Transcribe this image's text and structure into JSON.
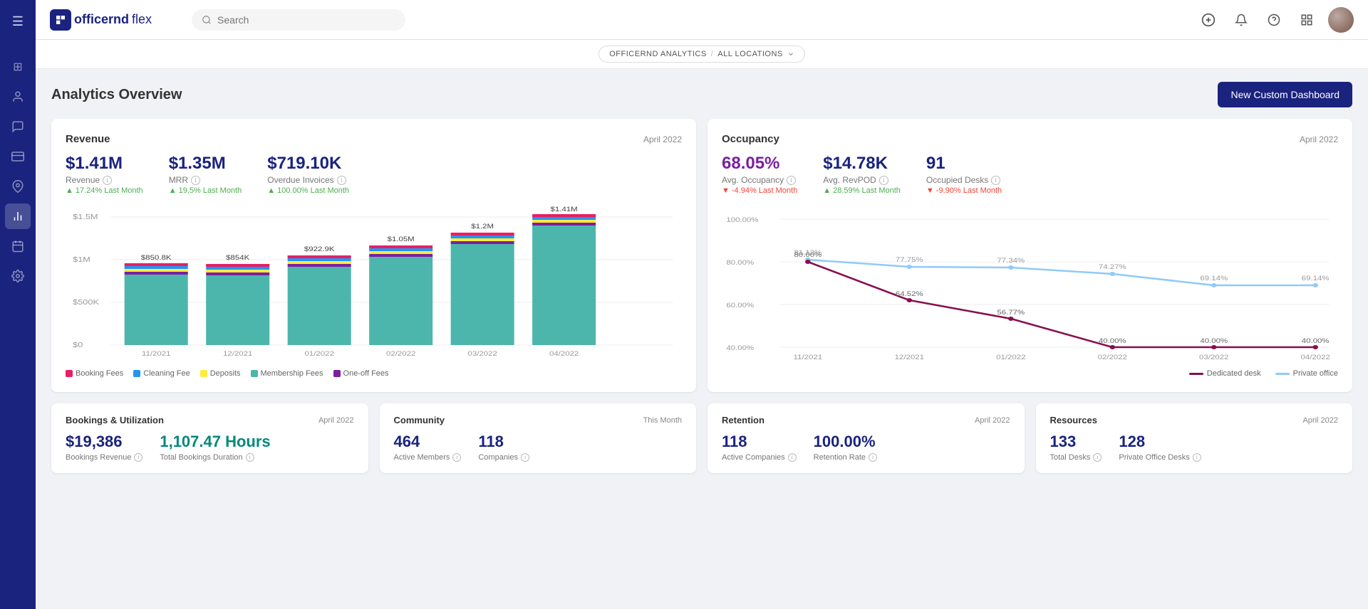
{
  "app": {
    "name": "officernd",
    "subtitle": "flex"
  },
  "nav": {
    "search_placeholder": "Search",
    "location_text": "OFFICERND ANALYTICS",
    "location_sep": "/",
    "location_scope": "ALL LOCATIONS"
  },
  "page": {
    "title": "Analytics Overview",
    "new_dashboard_button": "New Custom Dashboard"
  },
  "revenue_card": {
    "title": "Revenue",
    "period": "April 2022",
    "metrics": [
      {
        "value": "$1.41M",
        "label": "Revenue",
        "change": "17.24% Last Month",
        "direction": "up"
      },
      {
        "value": "$1.35M",
        "label": "MRR",
        "change": "19.5% Last Month",
        "direction": "up"
      },
      {
        "value": "$719.10K",
        "label": "Overdue Invoices",
        "change": "100.00% Last Month",
        "direction": "up"
      }
    ],
    "chart": {
      "y_labels": [
        "$1.5M",
        "$1M",
        "$500K",
        "$0"
      ],
      "bars": [
        {
          "month": "11/2021",
          "total": "$850.8K",
          "booking": 5,
          "cleaning": 3,
          "deposit": 2,
          "membership": 78,
          "oneoff": 12
        },
        {
          "month": "12/2021",
          "total": "$854K",
          "booking": 4,
          "cleaning": 3,
          "deposit": 2,
          "membership": 79,
          "oneoff": 12
        },
        {
          "month": "01/2022",
          "total": "$922.9K",
          "booking": 4,
          "cleaning": 3,
          "deposit": 2,
          "membership": 80,
          "oneoff": 11
        },
        {
          "month": "02/2022",
          "total": "$1.05M",
          "booking": 4,
          "cleaning": 3,
          "deposit": 2,
          "membership": 80,
          "oneoff": 11
        },
        {
          "month": "03/2022",
          "total": "$1.2M",
          "booking": 4,
          "cleaning": 3,
          "deposit": 2,
          "membership": 80,
          "oneoff": 11
        },
        {
          "month": "04/2022",
          "total": "$1.41M",
          "booking": 4,
          "cleaning": 3,
          "deposit": 2,
          "membership": 80,
          "oneoff": 11
        }
      ]
    },
    "legend": [
      {
        "label": "Booking Fees",
        "color": "#e91e63"
      },
      {
        "label": "Cleaning Fee",
        "color": "#2196f3"
      },
      {
        "label": "Deposits",
        "color": "#ffeb3b"
      },
      {
        "label": "Membership Fees",
        "color": "#4db6ac"
      },
      {
        "label": "One-off Fees",
        "color": "#7b1fa2"
      }
    ]
  },
  "occupancy_card": {
    "title": "Occupancy",
    "period": "April 2022",
    "metrics": [
      {
        "value": "68.05%",
        "label": "Avg. Occupancy",
        "change": "-4.94% Last Month",
        "direction": "down"
      },
      {
        "value": "$14.78K",
        "label": "Avg. RevPOD",
        "change": "28.59% Last Month",
        "direction": "up"
      },
      {
        "value": "91",
        "label": "Occupied Desks",
        "change": "-9.90% Last Month",
        "direction": "down"
      }
    ],
    "chart": {
      "y_labels": [
        "100.00%",
        "80.00%",
        "60.00%",
        "40.00%"
      ],
      "x_labels": [
        "11/2021",
        "12/2021",
        "01/2022",
        "02/2022",
        "03/2022",
        "04/2022"
      ],
      "dedicated_desk_points": [
        {
          "x": 0,
          "y": 80.0
        },
        {
          "x": 1,
          "y": 64.52
        },
        {
          "x": 2,
          "y": 56.77
        },
        {
          "x": 3,
          "y": 40.0
        },
        {
          "x": 4,
          "y": 40.0
        },
        {
          "x": 5,
          "y": 40.0
        }
      ],
      "private_office_points": [
        {
          "x": 0,
          "y": 81.12
        },
        {
          "x": 1,
          "y": 77.75
        },
        {
          "x": 2,
          "y": 77.34
        },
        {
          "x": 3,
          "y": 74.27
        },
        {
          "x": 4,
          "y": 69.14
        },
        {
          "x": 5,
          "y": 69.14
        }
      ],
      "dedicated_desk_labels": [
        "80.00%",
        "64.52%",
        "56.77%",
        "40.00%",
        "40.00%",
        "40.00%"
      ],
      "private_office_labels": [
        "81.12%",
        "77.75%",
        "77.34%",
        "74.27%",
        "69.14%",
        "69.14%"
      ]
    },
    "legend": [
      {
        "label": "Dedicated desk",
        "color": "#880e4f"
      },
      {
        "label": "Private office",
        "color": "#90caf9"
      }
    ]
  },
  "bottom_cards": [
    {
      "id": "bookings",
      "title": "Bookings & Utilization",
      "period": "April 2022",
      "metrics": [
        {
          "value": "$19,386",
          "label": "Bookings Revenue",
          "color": "blue"
        },
        {
          "value": "1,107.47 Hours",
          "label": "Total Bookings Duration",
          "color": "teal"
        }
      ]
    },
    {
      "id": "community",
      "title": "Community",
      "period": "This Month",
      "metrics": [
        {
          "value": "464",
          "label": "Active Members",
          "color": "blue"
        },
        {
          "value": "118",
          "label": "Companies",
          "color": "blue"
        }
      ]
    },
    {
      "id": "retention",
      "title": "Retention",
      "period": "April 2022",
      "metrics": [
        {
          "value": "118",
          "label": "Active Companies",
          "color": "blue"
        },
        {
          "value": "100.00%",
          "label": "Retention Rate",
          "color": "blue"
        }
      ]
    },
    {
      "id": "resources",
      "title": "Resources",
      "period": "April 2022",
      "metrics": [
        {
          "value": "133",
          "label": "Total Desks",
          "color": "blue"
        },
        {
          "value": "128",
          "label": "Private Office Desks",
          "color": "blue"
        }
      ]
    }
  ],
  "sidebar_icons": [
    {
      "name": "hamburger-icon",
      "symbol": "☰",
      "active": true
    },
    {
      "name": "dashboard-icon",
      "symbol": "⊞",
      "active": false
    },
    {
      "name": "people-icon",
      "symbol": "👤",
      "active": false
    },
    {
      "name": "chat-icon",
      "symbol": "💬",
      "active": false
    },
    {
      "name": "card-icon",
      "symbol": "💳",
      "active": false
    },
    {
      "name": "location-icon",
      "symbol": "📍",
      "active": false
    },
    {
      "name": "chart-icon",
      "symbol": "📊",
      "active": true
    },
    {
      "name": "calendar-icon",
      "symbol": "📅",
      "active": false
    },
    {
      "name": "settings-icon",
      "symbol": "⚙",
      "active": false
    }
  ]
}
